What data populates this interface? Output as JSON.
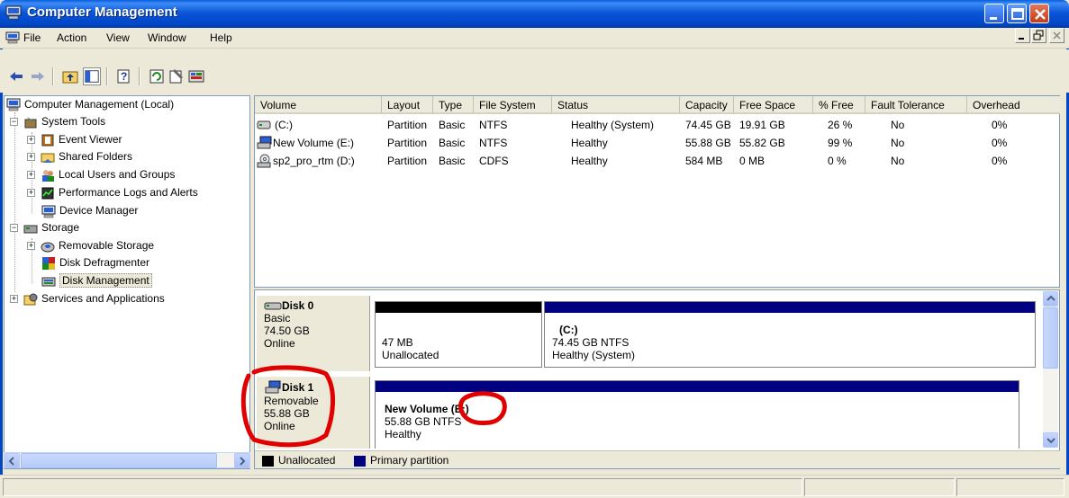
{
  "window": {
    "title": "Computer Management"
  },
  "menu": {
    "items": [
      "File",
      "Action",
      "View",
      "Window",
      "Help"
    ]
  },
  "tree": {
    "root": "Computer Management (Local)",
    "system_tools": "System Tools",
    "event_viewer": "Event Viewer",
    "shared_folders": "Shared Folders",
    "local_users": "Local Users and Groups",
    "perf_logs": "Performance Logs and Alerts",
    "device_manager": "Device Manager",
    "storage": "Storage",
    "removable_storage": "Removable Storage",
    "disk_defrag": "Disk Defragmenter",
    "disk_management": "Disk Management",
    "services_apps": "Services and Applications"
  },
  "volume_table": {
    "columns": [
      "Volume",
      "Layout",
      "Type",
      "File System",
      "Status",
      "Capacity",
      "Free Space",
      "% Free",
      "Fault Tolerance",
      "Overhead"
    ],
    "rows": [
      [
        "(C:)",
        "Partition",
        "Basic",
        "NTFS",
        "Healthy (System)",
        "74.45 GB",
        "19.91 GB",
        "26 %",
        "No",
        "0%"
      ],
      [
        "New Volume (E:)",
        "Partition",
        "Basic",
        "NTFS",
        "Healthy",
        "55.88 GB",
        "55.82 GB",
        "99 %",
        "No",
        "0%"
      ],
      [
        "sp2_pro_rtm (D:)",
        "Partition",
        "Basic",
        "CDFS",
        "Healthy",
        "584 MB",
        "0 MB",
        "0 %",
        "No",
        "0%"
      ]
    ]
  },
  "disks": {
    "disk0": {
      "name": "Disk 0",
      "type": "Basic",
      "size": "74.50 GB",
      "state": "Online",
      "part1": {
        "size": "47 MB",
        "status": "Unallocated"
      },
      "part2": {
        "name": "(C:)",
        "detail": "74.45 GB NTFS",
        "status": "Healthy (System)"
      }
    },
    "disk1": {
      "name": "Disk 1",
      "type": "Removable",
      "size": "55.88 GB",
      "state": "Online",
      "part1": {
        "name": "New Volume (E:)",
        "detail": "55.88 GB NTFS",
        "status": "Healthy"
      }
    }
  },
  "legend": {
    "unallocated": "Unallocated",
    "primary": "Primary partition"
  },
  "colors": {
    "unallocated": "#000000",
    "primary": "#000080",
    "titlebar": "#0a56d8",
    "annotation": "#e00000"
  }
}
